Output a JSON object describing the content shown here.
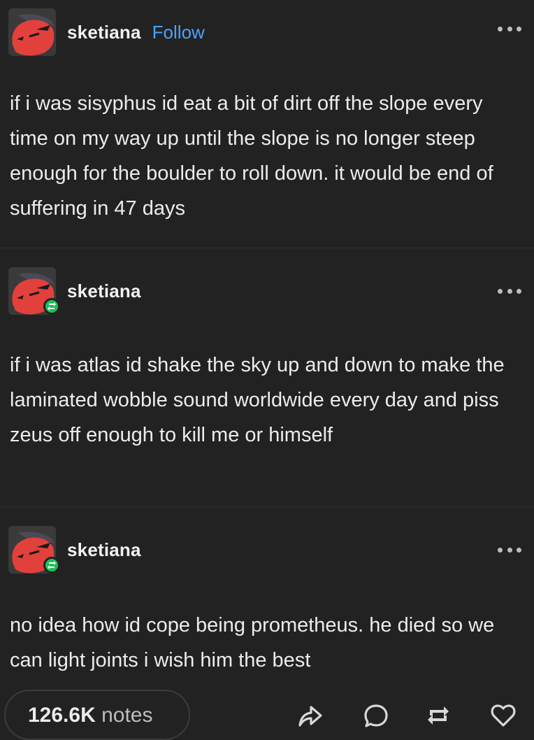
{
  "posts": [
    {
      "username": "sketiana",
      "follow_label": "Follow",
      "text": "if i was sisyphus id eat a bit of dirt off the slope every time on my way up until the slope is no longer steep enough for the boulder to roll down. it would be end of suffering in 47 days"
    },
    {
      "username": "sketiana",
      "text": "if i was atlas id shake the sky up and down to make the laminated wobble sound worldwide every day and piss zeus off enough to kill me or himself"
    },
    {
      "username": "sketiana",
      "text": "no idea how id cope being prometheus. he died so we can light joints i wish him the best"
    }
  ],
  "footer": {
    "notes_count": "126.6K",
    "notes_label": "notes"
  },
  "icons": {
    "more": "more-dots-icon",
    "share": "share-icon",
    "comment": "comment-icon",
    "reblog": "reblog-icon",
    "like": "heart-icon",
    "reblog_badge": "reblog-badge-icon"
  },
  "colors": {
    "background": "#222222",
    "follow": "#4ba3ff",
    "reblog_badge": "#1ec05a",
    "avatar": "#e2403b"
  }
}
